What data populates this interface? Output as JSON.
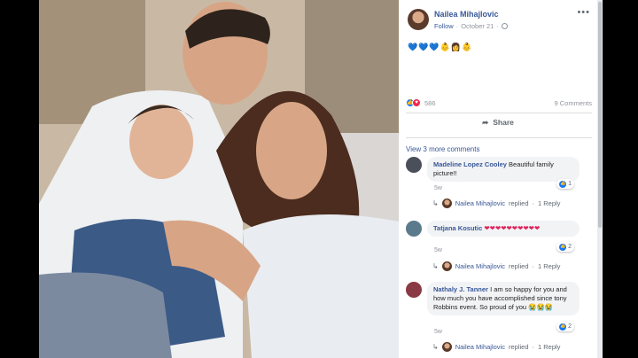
{
  "post": {
    "author": "Nailea Mihajlovic",
    "follow_label": "Follow",
    "separator": "·",
    "date": "October 21",
    "text": "💙💙💙👶👩👶",
    "reactions_count": "586",
    "comments_count": "9 Comments",
    "share_label": "Share",
    "view_more_label": "View 3 more comments",
    "more_icon": "•••"
  },
  "comments": [
    {
      "author": "Madeline Lopez Cooley",
      "text": "Beautiful family picture!!",
      "time": "5w",
      "reaction_count": "1",
      "reply_author": "Nailea Mihajlovic",
      "reply_label": "replied",
      "reply_count": "1 Reply",
      "avatar_color": "#4a4f5a"
    },
    {
      "author": "Tatjana Kosutic",
      "text": "❤❤❤❤❤❤❤❤❤❤",
      "time": "5w",
      "reaction_count": "2",
      "reply_author": "Nailea Mihajlovic",
      "reply_label": "replied",
      "reply_count": "1 Reply",
      "avatar_color": "#5b7a8c"
    },
    {
      "author": "Nathaly J. Tanner",
      "text": "I am so happy for you and how much you have accomplished since tony Robbins event. So proud of you 😭😭😭",
      "time": "5w",
      "reaction_count": "2",
      "reply_author": "Nailea Mihajlovic",
      "reply_label": "replied",
      "reply_count": "1 Reply",
      "avatar_color": "#8a3a44"
    }
  ],
  "colors": {
    "link": "#385898",
    "like": "#1877f2",
    "love": "#f0284a",
    "bubble": "#f2f3f5"
  },
  "icons": {
    "share": "share-arrow-icon",
    "reply": "reply-arrow-icon",
    "globe": "globe-icon"
  }
}
